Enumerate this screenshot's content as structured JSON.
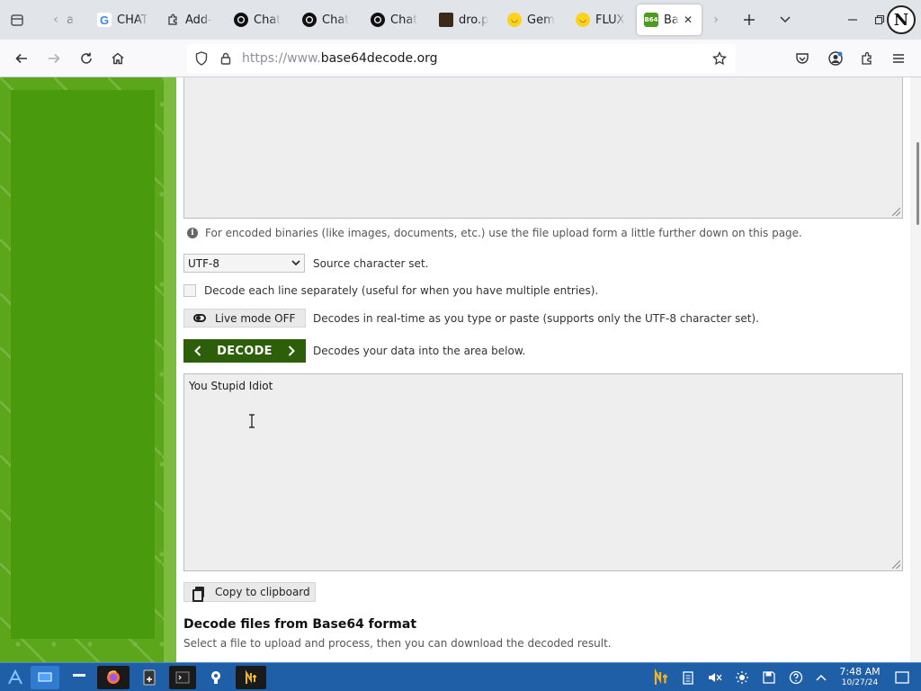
{
  "browser": {
    "tabs": [
      {
        "title": "a",
        "icon": "tab-icon"
      },
      {
        "title": "CHAT",
        "icon": "google-icon"
      },
      {
        "title": "Add-",
        "icon": "puzzle-icon"
      },
      {
        "title": "Chat",
        "icon": "openai-icon"
      },
      {
        "title": "Chat",
        "icon": "openai-icon"
      },
      {
        "title": "Chat",
        "icon": "openai-icon"
      },
      {
        "title": "dro.p",
        "icon": "image-icon"
      },
      {
        "title": "Gem",
        "icon": "huggingface-icon"
      },
      {
        "title": "FLUX",
        "icon": "huggingface-icon"
      },
      {
        "title": "Ba",
        "icon": "base64-icon",
        "active": true
      }
    ],
    "favicon_b64_label": "B64",
    "google_favicon_letter": "G",
    "profile_initial": "N",
    "address": {
      "scheme": "https://www.",
      "host": "base64decode.org"
    }
  },
  "page": {
    "info_text": "For encoded binaries (like images, documents, etc.) use the file upload form a little further down on this page.",
    "charset": {
      "value": "UTF-8",
      "label": "Source character set."
    },
    "decode_each_line": {
      "checked": false,
      "label": "Decode each line separately (useful for when you have multiple entries)."
    },
    "live_mode": {
      "button_label": "Live mode OFF",
      "description": "Decodes in real-time as you type or paste (supports only the UTF-8 character set)."
    },
    "decode": {
      "button_label": "DECODE",
      "description": "Decodes your data into the area below."
    },
    "result_text": "You Stupid Idiot",
    "copy_button_label": "Copy to clipboard",
    "files_section": {
      "heading": "Decode files from Base64 format",
      "subtext": "Select a file to upload and process, then you can download the decoded result."
    },
    "colors": {
      "brand_green": "#5ba61a",
      "decode_button": "#2d5e0a"
    }
  },
  "taskbar": {
    "time": "7:48 AM",
    "date": "10/27/24"
  }
}
